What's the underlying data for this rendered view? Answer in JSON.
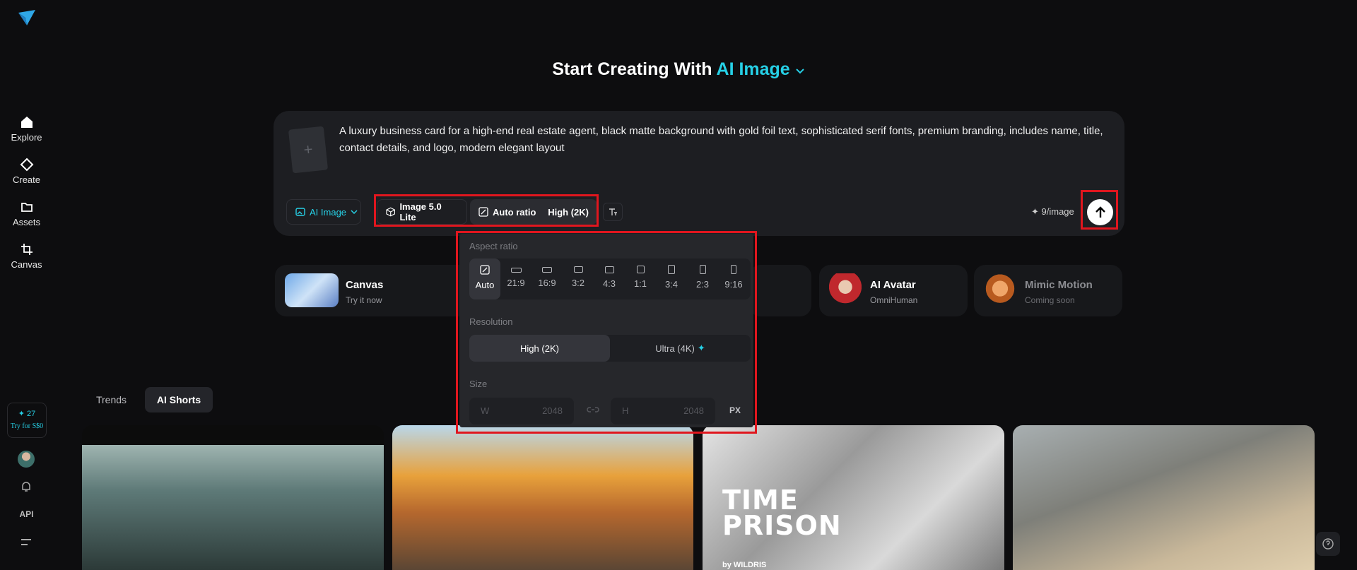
{
  "sidebar": {
    "items": [
      {
        "label": "Explore",
        "icon": "home-icon"
      },
      {
        "label": "Create",
        "icon": "diamond-icon"
      },
      {
        "label": "Assets",
        "icon": "folder-icon"
      },
      {
        "label": "Canvas",
        "icon": "crop-icon"
      }
    ],
    "credits": "27",
    "try_label": "Try for S$0",
    "api_label": "API"
  },
  "heading": {
    "prefix": "Start Creating With",
    "accent": "AI Image"
  },
  "prompt": {
    "text": "A luxury business card for a high-end real estate agent, black matte background with gold foil text, sophisticated serif fonts, premium branding, includes name, title, contact details, and logo, modern elegant layout",
    "upload_plus": "+",
    "mode_label": "AI Image",
    "model_label": "Image 5.0 Lite",
    "ratio_label": "Auto ratio",
    "resolution_label": "High (2K)",
    "cost": "9/image"
  },
  "features": [
    {
      "name": "Canvas",
      "sub": "Try it now"
    },
    {
      "name": "AI Avatar",
      "sub": "OmniHuman"
    },
    {
      "name": "Mimic Motion",
      "sub": "Coming soon"
    }
  ],
  "tabs": [
    "Trends",
    "AI Shorts"
  ],
  "gallery": {
    "card3_title_line1": "TIME",
    "card3_title_line2": "PRISON",
    "card3_sub": "by WILDRIS"
  },
  "popover": {
    "aspect_label": "Aspect ratio",
    "ratios": [
      "Auto",
      "21:9",
      "16:9",
      "3:2",
      "4:3",
      "1:1",
      "3:4",
      "2:3",
      "9:16"
    ],
    "resolution_label": "Resolution",
    "resolutions": [
      "High (2K)",
      "Ultra (4K)"
    ],
    "size_label": "Size",
    "w_label": "W",
    "w_value": "2048",
    "h_label": "H",
    "h_value": "2048",
    "unit": "PX"
  },
  "colors": {
    "accent": "#26d0e6",
    "highlight": "#e0161e",
    "panel": "#1d1e22"
  }
}
